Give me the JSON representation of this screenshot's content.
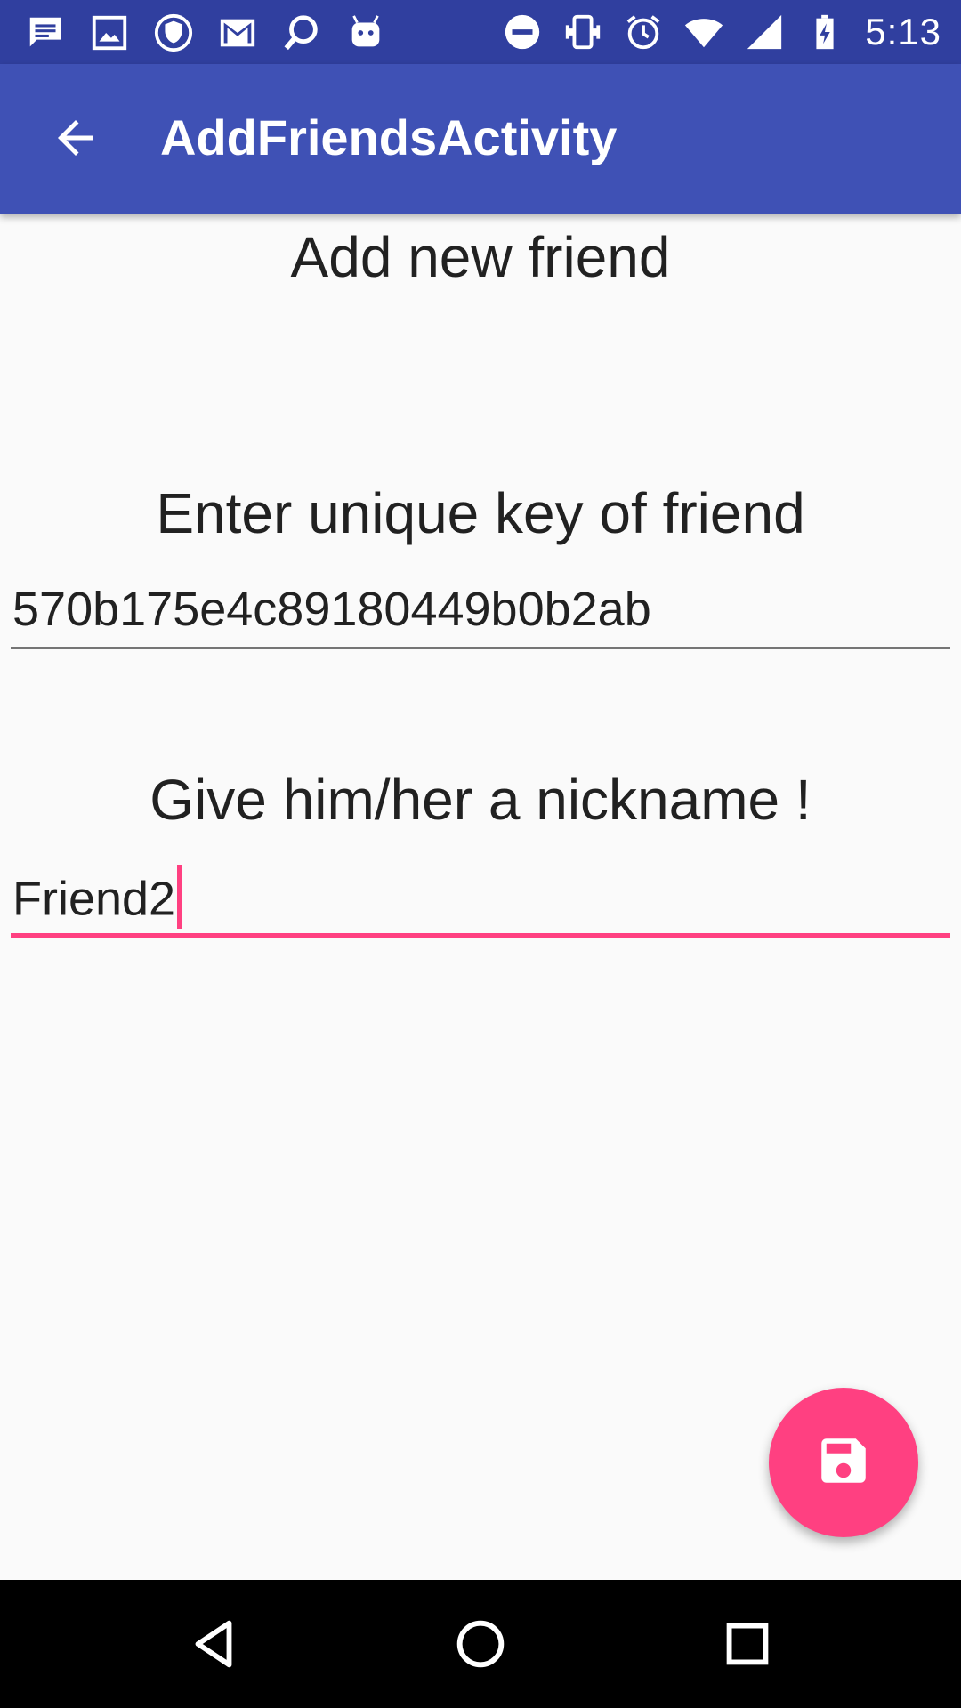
{
  "status_bar": {
    "time": "5:13",
    "left_icons": [
      "message-icon",
      "image-icon",
      "vpn-shield-icon",
      "gmail-icon",
      "chat-search-icon",
      "android-icon"
    ],
    "right_icons": [
      "do-not-disturb-icon",
      "vibrate-icon",
      "alarm-icon",
      "wifi-icon",
      "signal-icon",
      "battery-charging-icon"
    ]
  },
  "app_bar": {
    "title": "AddFriendsActivity",
    "back_icon": "arrow-back-icon"
  },
  "form": {
    "heading": "Add new friend",
    "key_label": "Enter unique key of friend",
    "key_value": "570b175e4c89180449b0b2ab",
    "nickname_label": "Give him/her a nickname !",
    "nickname_value": "Friend2"
  },
  "fab": {
    "icon": "save-icon",
    "color": "#ff4081"
  },
  "colors": {
    "primary": "#3f51b5",
    "primary_dark": "#303f9f",
    "accent": "#ff4081"
  }
}
